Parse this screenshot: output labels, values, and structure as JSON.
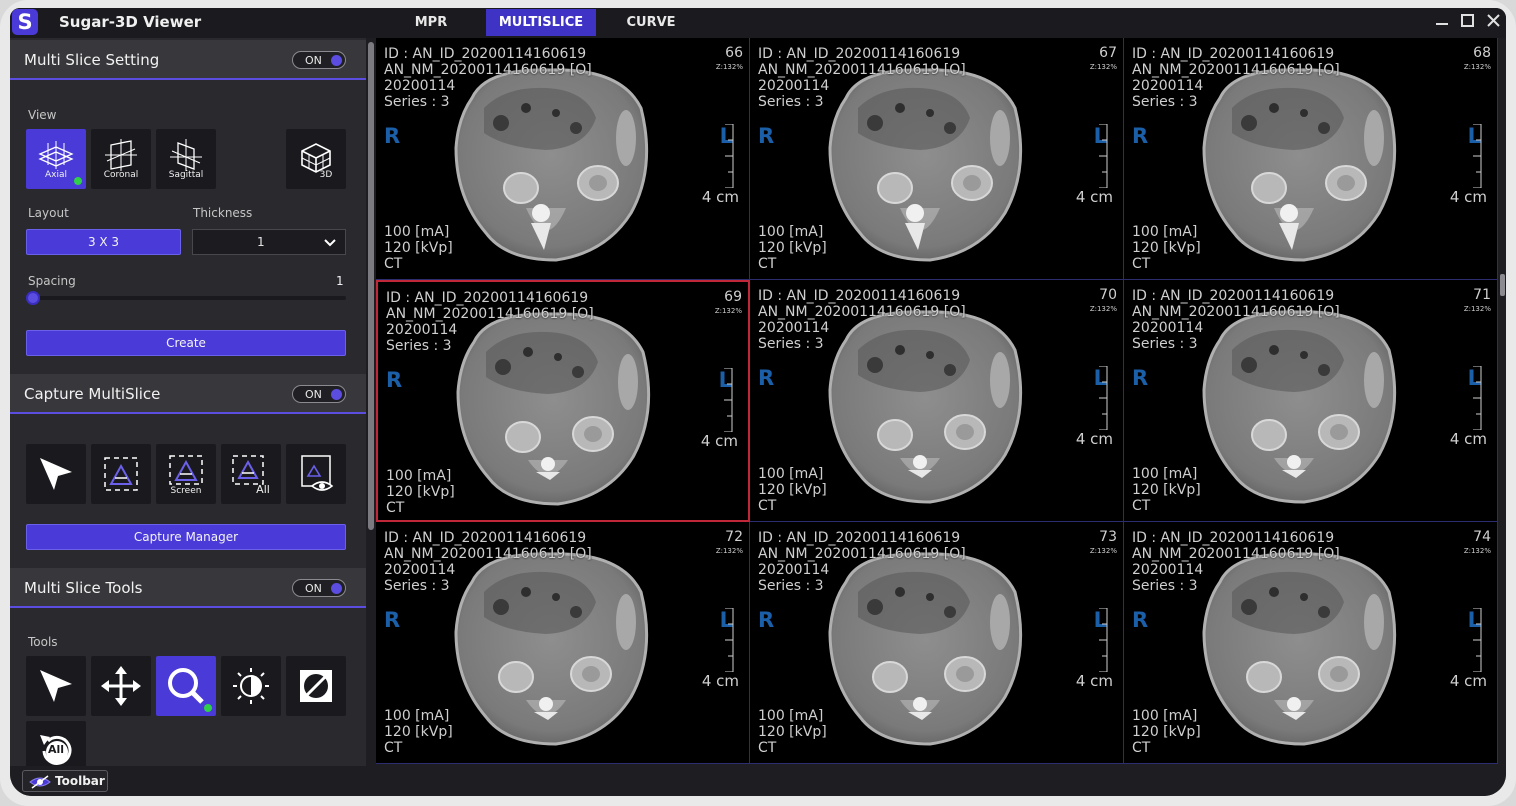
{
  "app": {
    "title": "Sugar-3D Viewer",
    "logo_letter": "S",
    "tabs": [
      {
        "label": "MPR",
        "active": false
      },
      {
        "label": "MULTISLICE",
        "active": true
      },
      {
        "label": "CURVE",
        "active": false
      }
    ],
    "window_controls": [
      "minimize-icon",
      "maximize-icon",
      "close-icon"
    ]
  },
  "multi_slice_setting": {
    "title": "Multi Slice Setting",
    "toggle": "ON",
    "view_label": "View",
    "views": [
      {
        "label": "Axial",
        "icon": "axial-plane-icon",
        "active": true
      },
      {
        "label": "Coronal",
        "icon": "coronal-plane-icon",
        "active": false
      },
      {
        "label": "Sagittal",
        "icon": "sagittal-plane-icon",
        "active": false
      },
      {
        "label": "3D",
        "icon": "cube-3d-icon",
        "active": false
      }
    ],
    "layout_label": "Layout",
    "layout_value": "3 X 3",
    "thickness_label": "Thickness",
    "thickness_value": "1",
    "spacing_label": "Spacing",
    "spacing_value": "1",
    "create_label": "Create"
  },
  "capture_multislice": {
    "title": "Capture MultiSlice",
    "toggle": "ON",
    "tools": [
      {
        "icon": "pointer-icon",
        "label": ""
      },
      {
        "icon": "capture-region-icon",
        "label": ""
      },
      {
        "icon": "capture-screen-icon",
        "label": "Screen"
      },
      {
        "icon": "capture-all-icon",
        "label": "All"
      },
      {
        "icon": "capture-preview-icon",
        "label": ""
      }
    ],
    "manager_label": "Capture Manager"
  },
  "multi_slice_tools": {
    "title": "Multi Slice Tools",
    "toggle": "ON",
    "tools_label": "Tools",
    "tools": [
      {
        "icon": "pointer-icon",
        "active": false
      },
      {
        "icon": "pan-move-icon",
        "active": false
      },
      {
        "icon": "zoom-magnifier-icon",
        "active": true
      },
      {
        "icon": "window-level-icon",
        "active": false
      },
      {
        "icon": "invert-icon",
        "active": false
      },
      {
        "icon": "reset-all-icon",
        "label": "All",
        "active": false
      }
    ]
  },
  "bottom": {
    "toolbar_label": "Toolbar"
  },
  "viewer": {
    "cells": [
      {
        "id": "ID : AN_ID_20200114160619",
        "name": "AN_NM_20200114160619 [O]",
        "date": "20200114",
        "series": "Series : 3",
        "slice": "66",
        "zoom": "Z:132%",
        "r": "R",
        "l": "L",
        "scale": "4 cm",
        "ma": "100  [mA]",
        "kvp": "120  [kVp]",
        "mod": "CT",
        "selected": false
      },
      {
        "id": "ID : AN_ID_20200114160619",
        "name": "AN_NM_20200114160619 [O]",
        "date": "20200114",
        "series": "Series : 3",
        "slice": "67",
        "zoom": "Z:132%",
        "r": "R",
        "l": "L",
        "scale": "4 cm",
        "ma": "100  [mA]",
        "kvp": "120  [kVp]",
        "mod": "CT",
        "selected": false
      },
      {
        "id": "ID : AN_ID_20200114160619",
        "name": "AN_NM_20200114160619 [O]",
        "date": "20200114",
        "series": "Series : 3",
        "slice": "68",
        "zoom": "Z:132%",
        "r": "R",
        "l": "L",
        "scale": "4 cm",
        "ma": "100  [mA]",
        "kvp": "120  [kVp]",
        "mod": "CT",
        "selected": false
      },
      {
        "id": "ID : AN_ID_20200114160619",
        "name": "AN_NM_20200114160619 [O]",
        "date": "20200114",
        "series": "Series : 3",
        "slice": "69",
        "zoom": "Z:132%",
        "r": "R",
        "l": "L",
        "scale": "4 cm",
        "ma": "100  [mA]",
        "kvp": "120  [kVp]",
        "mod": "CT",
        "selected": true
      },
      {
        "id": "ID : AN_ID_20200114160619",
        "name": "AN_NM_20200114160619 [O]",
        "date": "20200114",
        "series": "Series : 3",
        "slice": "70",
        "zoom": "Z:132%",
        "r": "R",
        "l": "L",
        "scale": "4 cm",
        "ma": "100  [mA]",
        "kvp": "120  [kVp]",
        "mod": "CT",
        "selected": false
      },
      {
        "id": "ID : AN_ID_20200114160619",
        "name": "AN_NM_20200114160619 [O]",
        "date": "20200114",
        "series": "Series : 3",
        "slice": "71",
        "zoom": "Z:132%",
        "r": "R",
        "l": "L",
        "scale": "4 cm",
        "ma": "100  [mA]",
        "kvp": "120  [kVp]",
        "mod": "CT",
        "selected": false
      },
      {
        "id": "ID : AN_ID_20200114160619",
        "name": "AN_NM_20200114160619 [O]",
        "date": "20200114",
        "series": "Series : 3",
        "slice": "72",
        "zoom": "Z:132%",
        "r": "R",
        "l": "L",
        "scale": "4 cm",
        "ma": "100  [mA]",
        "kvp": "120  [kVp]",
        "mod": "CT",
        "selected": false
      },
      {
        "id": "ID : AN_ID_20200114160619",
        "name": "AN_NM_20200114160619 [O]",
        "date": "20200114",
        "series": "Series : 3",
        "slice": "73",
        "zoom": "Z:132%",
        "r": "R",
        "l": "L",
        "scale": "4 cm",
        "ma": "100  [mA]",
        "kvp": "120  [kVp]",
        "mod": "CT",
        "selected": false
      },
      {
        "id": "ID : AN_ID_20200114160619",
        "name": "AN_NM_20200114160619 [O]",
        "date": "20200114",
        "series": "Series : 3",
        "slice": "74",
        "zoom": "Z:132%",
        "r": "R",
        "l": "L",
        "scale": "4 cm",
        "ma": "100  [mA]",
        "kvp": "120  [kVp]",
        "mod": "CT",
        "selected": false
      }
    ]
  },
  "colors": {
    "accent": "#4a3ad8",
    "panel": "#2a2a2e",
    "header": "#38383c",
    "selected_border": "#c0283a",
    "orientation": "#1b5fa8",
    "active_dot": "#2fcf4a"
  }
}
